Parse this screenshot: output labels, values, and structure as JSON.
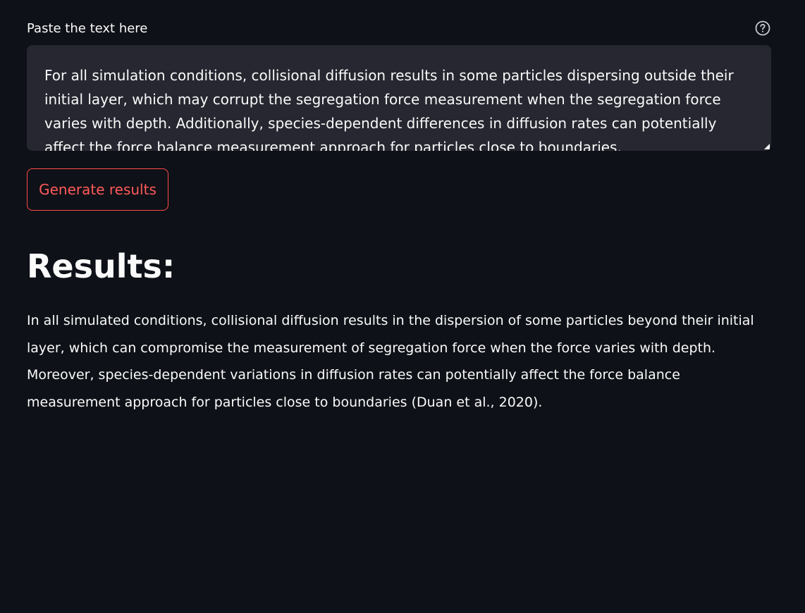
{
  "input": {
    "label": "Paste the text here",
    "value": "For all simulation conditions, collisional diffusion results in some particles dispersing outside their initial layer, which may corrupt the segregation force measurement when the segregation force varies with depth. Additionally, species-dependent differences in diffusion rates can potentially affect the force balance measurement approach for particles close to boundaries.",
    "help_icon": "question-circle-icon"
  },
  "actions": {
    "generate_label": "Generate results"
  },
  "results": {
    "heading": "Results:",
    "text": "In all simulated conditions, collisional diffusion results in the dispersion of some particles beyond their initial layer, which can compromise the measurement of segregation force when the force varies with depth. Moreover, species-dependent variations in diffusion rates can potentially affect the force balance measurement approach for particles close to boundaries (Duan et al., 2020)."
  },
  "colors": {
    "background": "#0e1117",
    "input_background": "#262730",
    "text": "#fafafa",
    "accent": "#ff4b4b"
  }
}
